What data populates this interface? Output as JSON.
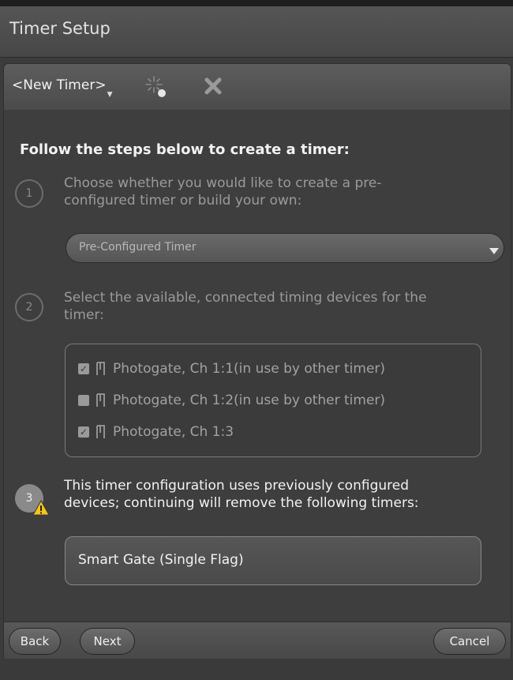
{
  "window": {
    "title": "Timer Setup"
  },
  "toolbar": {
    "timer_select": "<New Timer>",
    "new_icon": "new-timer-icon",
    "close_icon": "close-icon"
  },
  "main": {
    "heading": "Follow the steps below to create a timer:",
    "step1": {
      "number": "1",
      "text_line1": "Choose whether you would like to create a pre-",
      "text_line2": "configured timer or build your own:",
      "dropdown_value": "Pre-Configured Timer"
    },
    "step2": {
      "number": "2",
      "text_line1": "Select the available, connected timing devices for the",
      "text_line2": "timer:",
      "devices": [
        {
          "label": "Photogate, Ch 1:1(in use by other timer)",
          "checked": true
        },
        {
          "label": "Photogate, Ch 1:2(in use by other timer)",
          "checked": false
        },
        {
          "label": "Photogate, Ch 1:3",
          "checked": true
        }
      ]
    },
    "step3": {
      "number": "3",
      "warning_icon": "warning-icon",
      "text_line1": "This timer configuration uses previously configured",
      "text_line2": "devices; continuing will remove the following timers:",
      "removed_timer": "Smart Gate (Single Flag)"
    }
  },
  "footer": {
    "back_label": "Back",
    "next_label": "Next",
    "cancel_label": "Cancel"
  },
  "colors": {
    "background": "#3e3e3e",
    "title_bar": "#4e4e4e",
    "text_primary": "#f2f2f2",
    "text_disabled": "#9a9a9a",
    "warning": "#f5c518"
  }
}
